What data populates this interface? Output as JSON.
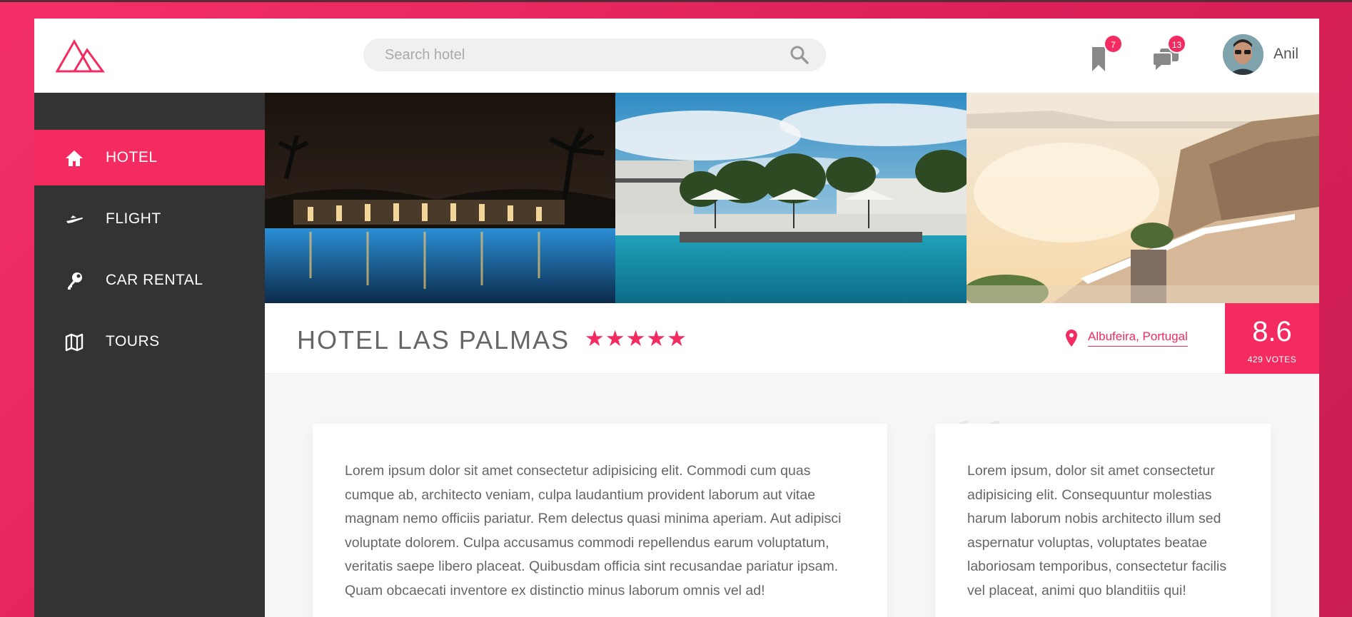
{
  "header": {
    "search": {
      "placeholder": "Search hotel"
    },
    "bookmarks": {
      "icon": "bookmark-icon",
      "count": "7"
    },
    "messages": {
      "icon": "chat-icon",
      "count": "13"
    },
    "user": {
      "name": "Anil"
    }
  },
  "sidebar": {
    "items": [
      {
        "label": "HOTEL",
        "icon": "home-icon",
        "active": true
      },
      {
        "label": "FLIGHT",
        "icon": "plane-icon",
        "active": false
      },
      {
        "label": "CAR RENTAL",
        "icon": "key-icon",
        "active": false
      },
      {
        "label": "TOURS",
        "icon": "map-icon",
        "active": false
      }
    ]
  },
  "hotel": {
    "name": "HOTEL LAS PALMAS",
    "stars": "★★★★★",
    "location": "Albufeira, Portugal",
    "score": "8.6",
    "votes": "429 VOTES"
  },
  "content": {
    "description": "Lorem ipsum dolor sit amet consectetur adipisicing elit. Commodi cum quas cumque ab, architecto veniam, culpa laudantium provident laborum aut vitae magnam nemo officiis pariatur. Rem delectus quasi minima aperiam. Aut adipisci voluptate dolorem. Culpa accusamus commodi repellendus earum voluptatum, veritatis saepe libero placeat. Quibusdam officia sint recusandae pariatur ipsam. Quam obcaecati inventore ex distinctio minus laborum omnis vel ad!",
    "quote": "Lorem ipsum, dolor sit amet consectetur adipisicing elit. Consequuntur molestias harum laborum nobis architecto illum sed aspernatur voluptas, voluptates beatae laboriosam temporibus, consectetur facilis vel placeat, animi quo blanditiis qui!"
  },
  "colors": {
    "accent": "#f42b60",
    "sidebar": "#333333"
  }
}
